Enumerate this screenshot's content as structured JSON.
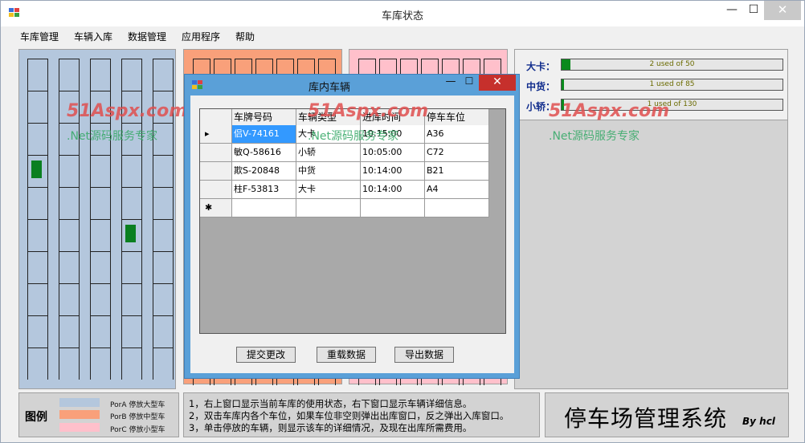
{
  "window": {
    "title": "车库状态"
  },
  "window_controls": {
    "minimize": "—",
    "maximize": "☐",
    "close": "✕"
  },
  "menu": [
    "车库管理",
    "车辆入库",
    "数据管理",
    "应用程序",
    "帮助"
  ],
  "stats": [
    {
      "label": "大卡：",
      "text": "2 used of 50",
      "used": 2,
      "total": 50
    },
    {
      "label": "中货：",
      "text": "1 used of 85",
      "used": 1,
      "total": 85
    },
    {
      "label": "小轿：",
      "text": "1 used of 130",
      "used": 1,
      "total": 130
    }
  ],
  "legend": {
    "title": "图例",
    "items": [
      {
        "text": "PorA 停放大型车",
        "color": "#b4c7dd"
      },
      {
        "text": "PorB 停放中型车",
        "color": "#f9a07a"
      },
      {
        "text": "PorC 停放小型车",
        "color": "#ffc0cb"
      }
    ]
  },
  "notes": [
    "1，右上窗口显示当前车库的使用状态，右下窗口显示车辆详细信息。",
    "2，双击车库内各个车位，如果车位非空则弹出出库窗口，反之弹出入库窗口。",
    "3，单击停放的车辆，则显示该车的详细情况，及现在出库所需费用。"
  ],
  "brand": {
    "title": "停车场管理系统",
    "by": "By hcl"
  },
  "dialog": {
    "title": "库内车辆",
    "columns": [
      "车牌号码",
      "车辆类型",
      "进库时间",
      "停车车位"
    ],
    "rows": [
      {
        "marker": "▸",
        "plate": "侣V-74161",
        "type": "大卡",
        "time": "10:15:00",
        "slot": "A36"
      },
      {
        "marker": "",
        "plate": "敏Q-58616",
        "type": "小轿",
        "time": "10:05:00",
        "slot": "C72"
      },
      {
        "marker": "",
        "plate": "欺S-20848",
        "type": "中货",
        "time": "10:14:00",
        "slot": "B21"
      },
      {
        "marker": "",
        "plate": "柱F-53813",
        "type": "大卡",
        "time": "10:14:00",
        "slot": "A4"
      }
    ],
    "new_row_marker": "✱",
    "buttons": {
      "submit": "提交更改",
      "reload": "重载数据",
      "export": "导出数据"
    }
  },
  "watermark": {
    "logo": "51Aspx.com",
    "sub": ".Net源码服务专家"
  },
  "colors": {
    "occupied": "#0a7f20",
    "dialog_frame": "#5aa0d8",
    "close_red": "#c6302c"
  }
}
